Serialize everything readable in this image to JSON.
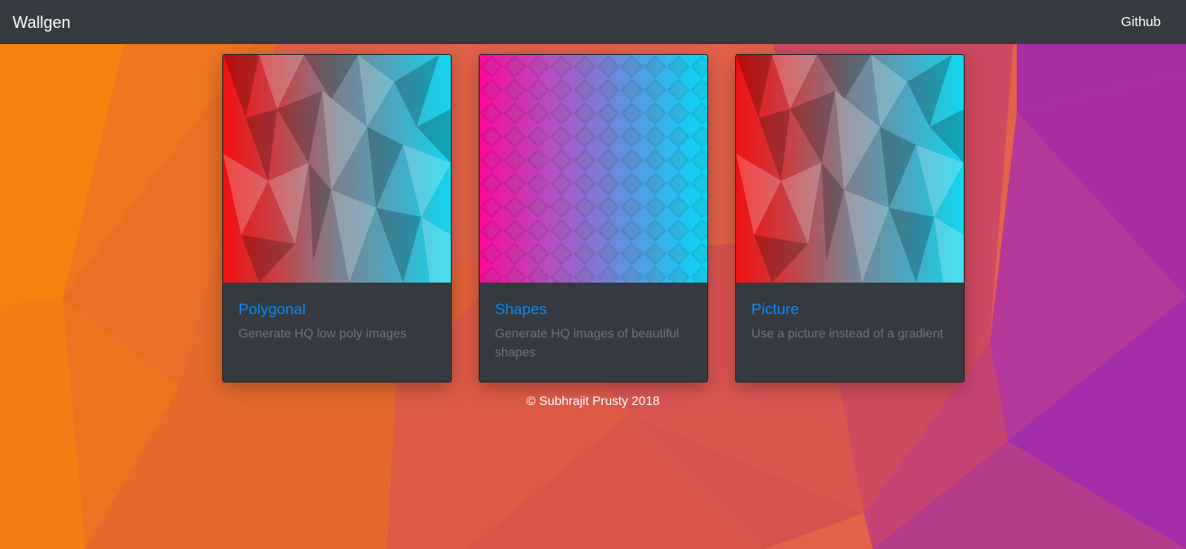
{
  "colors": {
    "navbar_bg": "#343a40",
    "card_bg": "#343a40",
    "card_title": "#0d8af7",
    "card_text": "#6c757d",
    "bg_orange": "#ef7a1d",
    "bg_red": "#d4534f",
    "bg_purple": "#a62fa7"
  },
  "navbar": {
    "brand": "Wallgen",
    "links": [
      {
        "label": "Github"
      }
    ]
  },
  "cards": [
    {
      "title": "Polygonal",
      "text": "Generate HQ low poly images",
      "thumbnail": "polygonal-red-cyan-gradient"
    },
    {
      "title": "Shapes",
      "text": "Generate HQ images of beautiful shapes",
      "thumbnail": "diamond-grid-pink-cyan-gradient"
    },
    {
      "title": "Picture",
      "text": "Use a picture instead of a gradient",
      "thumbnail": "polygonal-red-cyan-gradient"
    }
  ],
  "footer": {
    "text": "© Subhrajit Prusty 2018"
  }
}
